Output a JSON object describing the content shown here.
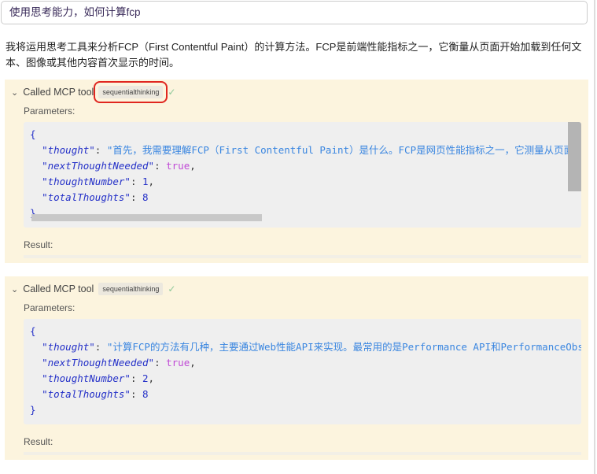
{
  "prompt": {
    "value": "使用思考能力，如何计算fcp"
  },
  "response": "我将运用思考工具来分析FCP（First Contentful Paint）的计算方法。FCP是前端性能指标之一，它衡量从页面开始加载到任何文本、图像或其他内容首次显示的时间。",
  "calls": [
    {
      "title": "Called MCP tool",
      "tool": "sequentialthinking",
      "params_label": "Parameters:",
      "result_label": "Result:",
      "lines": {
        "open": "{",
        "k1": "\"thought\"",
        "v1": "\"首先，我需要理解FCP（First Contentful Paint）是什么。FCP是网页性能指标之一，它测量从页面开始加载到",
        "k2": "\"nextThoughtNeeded\"",
        "v2": "true",
        "k3": "\"thoughtNumber\"",
        "v3": "1",
        "k4": "\"totalThoughts\"",
        "v4": "8",
        "close": "}"
      }
    },
    {
      "title": "Called MCP tool",
      "tool": "sequentialthinking",
      "params_label": "Parameters:",
      "result_label": "Result:",
      "lines": {
        "open": "{",
        "k1": "\"thought\"",
        "v1": "\"计算FCP的方法有几种，主要通过Web性能API来实现。最常用的是Performance API和PerformanceObserver",
        "k2": "\"nextThoughtNeeded\"",
        "v2": "true",
        "k3": "\"thoughtNumber\"",
        "v3": "2",
        "k4": "\"totalThoughts\"",
        "v4": "8",
        "close": "}"
      }
    }
  ]
}
